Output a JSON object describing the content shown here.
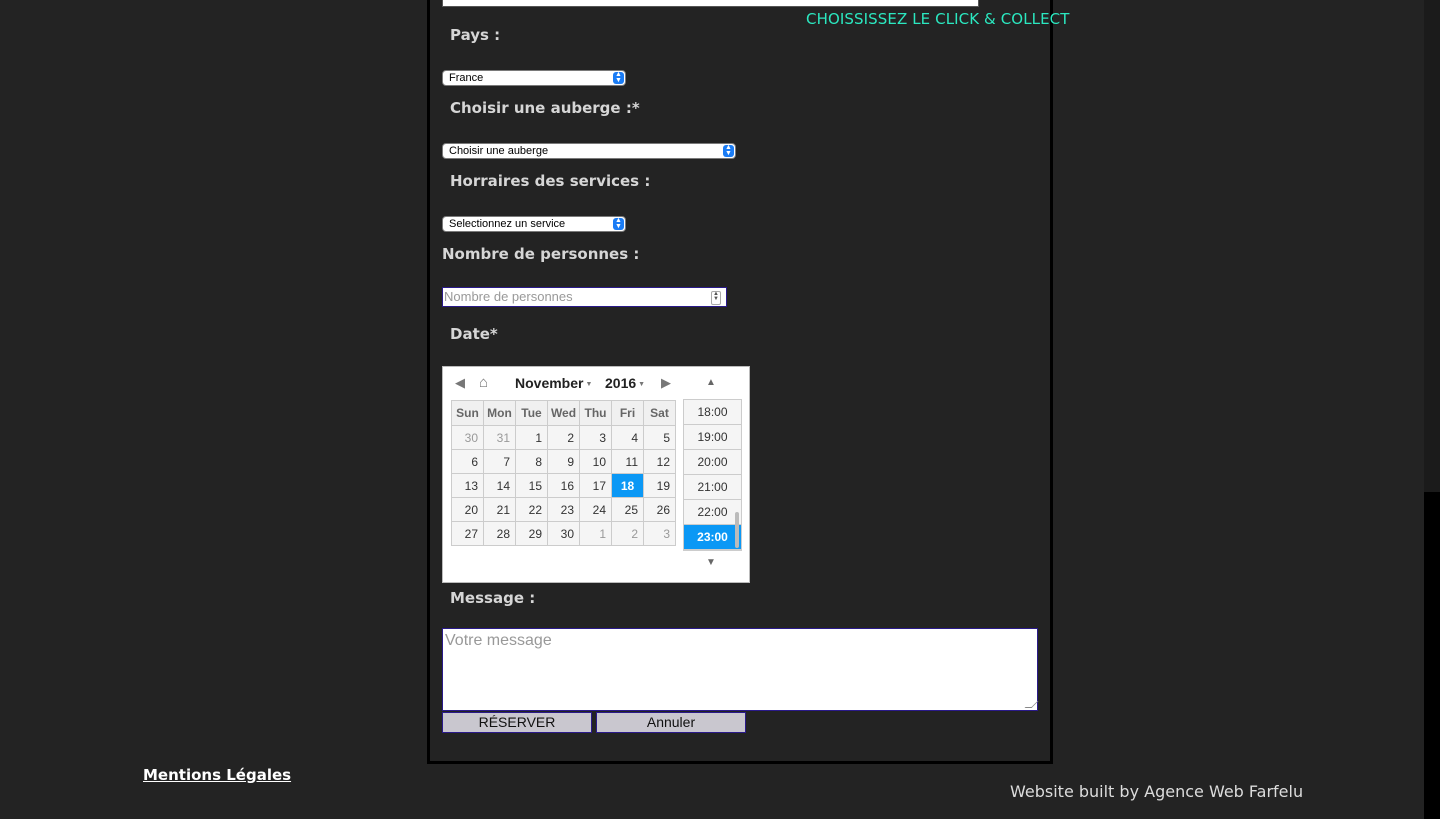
{
  "header": {
    "click_collect": "CHOISSISSEZ LE CLICK & COLLECT"
  },
  "form": {
    "country_label": "Pays :",
    "country_value": "France",
    "inn_label": "Choisir une auberge :*",
    "inn_value": "Choisir une auberge",
    "service_label": "Horraires des services :",
    "service_value": "Selectionnez un service",
    "people_label": "Nombre de personnes :",
    "people_placeholder": "Nombre de personnes",
    "date_label": "Date*",
    "message_label": "Message :",
    "message_placeholder": "Votre message",
    "reserve_button": "RÉSERVER",
    "cancel_button": "Annuler"
  },
  "calendar": {
    "month": "November",
    "year": "2016",
    "weekdays": [
      "Sun",
      "Mon",
      "Tue",
      "Wed",
      "Thu",
      "Fri",
      "Sat"
    ],
    "weeks": [
      [
        "30",
        "31",
        "1",
        "2",
        "3",
        "4",
        "5"
      ],
      [
        "6",
        "7",
        "8",
        "9",
        "10",
        "11",
        "12"
      ],
      [
        "13",
        "14",
        "15",
        "16",
        "17",
        "18",
        "19"
      ],
      [
        "20",
        "21",
        "22",
        "23",
        "24",
        "25",
        "26"
      ],
      [
        "27",
        "28",
        "29",
        "30",
        "1",
        "2",
        "3"
      ]
    ],
    "selected_day": "18",
    "times": [
      "18:00",
      "19:00",
      "20:00",
      "21:00",
      "22:00",
      "23:00"
    ],
    "selected_time": "23:00"
  },
  "footer": {
    "legal": "Mentions Légales",
    "built_by": "Website built by Agence Web Farfelu"
  },
  "colors": {
    "accent": "#2be8c0",
    "selected": "#0b98f5",
    "background": "#232323"
  }
}
